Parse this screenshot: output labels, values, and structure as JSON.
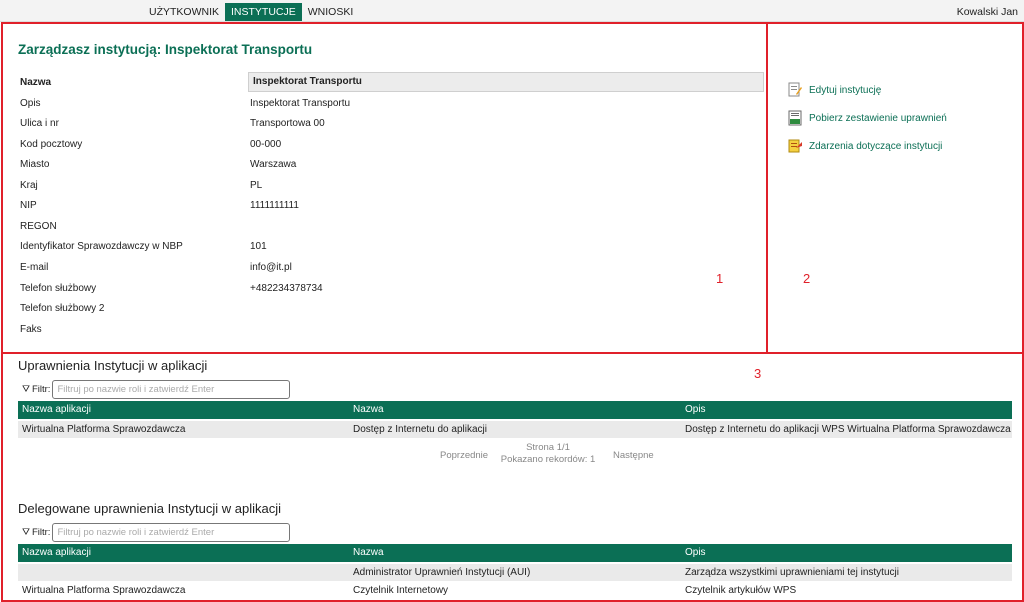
{
  "nav": {
    "items": [
      "UŻYTKOWNIK",
      "INSTYTUCJE",
      "WNIOSKI"
    ],
    "active_index": 1
  },
  "user": "Kowalski Jan",
  "header": {
    "title": "Zarządzasz instytucją: Inspektorat Transportu"
  },
  "details": [
    {
      "label": "Nazwa",
      "value": "Inspektorat Transportu"
    },
    {
      "label": "Opis",
      "value": "Inspektorat Transportu"
    },
    {
      "label": "Ulica i nr",
      "value": "Transportowa 00"
    },
    {
      "label": "Kod pocztowy",
      "value": "00-000"
    },
    {
      "label": "Miasto",
      "value": "Warszawa"
    },
    {
      "label": "Kraj",
      "value": "PL"
    },
    {
      "label": "NIP",
      "value": "1111111111"
    },
    {
      "label": "REGON",
      "value": ""
    },
    {
      "label": "Identyfikator Sprawozdawczy w NBP",
      "value": "101"
    },
    {
      "label": "E-mail",
      "value": "info@it.pl"
    },
    {
      "label": "Telefon służbowy",
      "value": "+482234378734"
    },
    {
      "label": "Telefon służbowy 2",
      "value": ""
    },
    {
      "label": "Faks",
      "value": ""
    }
  ],
  "actions": [
    {
      "label": "Edytuj instytucję",
      "icon": "edit-document-icon"
    },
    {
      "label": "Pobierz zestawienie uprawnień",
      "icon": "csv-download-icon"
    },
    {
      "label": "Zdarzenia dotyczące instytucji",
      "icon": "events-icon"
    }
  ],
  "annotations": [
    "1",
    "2",
    "3"
  ],
  "section1": {
    "title": "Uprawnienia Instytucji w aplikacji",
    "filter_label": "Filtr:",
    "filter_placeholder": "Filtruj po nazwie roli i zatwierdź Enter",
    "columns": [
      "Nazwa aplikacji",
      "Nazwa",
      "Opis"
    ],
    "rows": [
      [
        "Wirtualna Platforma Sprawozdawcza",
        "Dostęp z Internetu do aplikacji",
        "Dostęp z Internetu do aplikacji WPS Wirtualna Platforma Sprawozdawcza"
      ]
    ],
    "pager": {
      "prev": "Poprzednie",
      "page": "Strona 1/1",
      "records": "Pokazano rekordów: 1",
      "next": "Następne"
    }
  },
  "section2": {
    "title": "Delegowane uprawnienia Instytucji w aplikacji",
    "filter_label": "Filtr:",
    "filter_placeholder": "Filtruj po nazwie roli i zatwierdź Enter",
    "columns": [
      "Nazwa aplikacji",
      "Nazwa",
      "Opis"
    ],
    "rows": [
      [
        "",
        "Administrator Uprawnień Instytucji (AUI)",
        "Zarządza wszystkimi uprawnieniami tej instytucji"
      ],
      [
        "Wirtualna Platforma Sprawozdawcza",
        "Czytelnik Internetowy",
        "Czytelnik artykułów WPS"
      ]
    ]
  }
}
